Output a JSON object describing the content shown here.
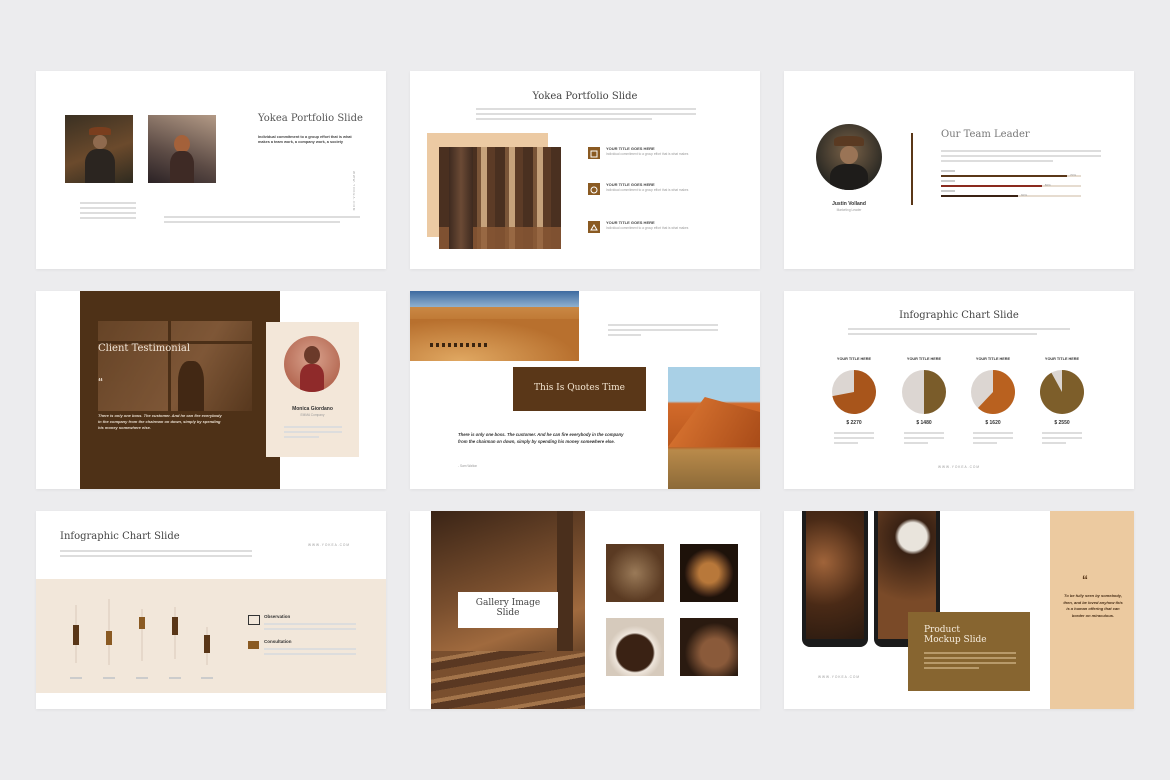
{
  "slide1": {
    "title": "Yokea Portfolio Slide",
    "lead": "Individual commitment to a group effort that is what makes a team work, a company work, a society",
    "vertical": "WWW.YOKEA.COM"
  },
  "slide2": {
    "title": "Yokea Portfolio Slide",
    "items": [
      {
        "title": "YOUR TITLE GOES HERE",
        "text": "Individual commitment to a group effort that is what makes"
      },
      {
        "title": "YOUR TITLE GOES HERE",
        "text": "Individual commitment to a group effort that is what makes"
      },
      {
        "title": "YOUR TITLE GOES HERE",
        "text": "Individual commitment to a group effort that is what makes"
      }
    ]
  },
  "slide3": {
    "title": "Our Team Leader",
    "name": "Justin Volland",
    "role": "Marketing Leader",
    "bars": [
      {
        "value": 0.9,
        "label": "70%"
      },
      {
        "value": 0.72,
        "label": "80%"
      },
      {
        "value": 0.55,
        "label": "60%"
      }
    ]
  },
  "slide4": {
    "title": "Client Testimonial",
    "quote": "There is only one boss. The customer. And he can fire everybody in the company from the chairman on down, simply by spending his money somewhere else.",
    "name": "Monica Giordano",
    "company": "EMMA Company"
  },
  "slide5": {
    "title": "This Is Quotes Time",
    "quote": "There is only one boss. The customer. And he can fire everybody in the company from the chairman on down, simply by spending his money somewhere else.",
    "author": "- Sam Walton"
  },
  "slide6": {
    "title": "Infographic Chart Slide",
    "items": [
      {
        "label": "YOUR TITLE HERE",
        "value": "$ 2270",
        "pct": 0.72,
        "color": "#a8551b"
      },
      {
        "label": "YOUR TITLE HERE",
        "value": "$ 1480",
        "pct": 0.5,
        "color": "#7a5c2a"
      },
      {
        "label": "YOUR TITLE HERE",
        "value": "$ 1620",
        "pct": 0.62,
        "color": "#b9611f"
      },
      {
        "label": "YOUR TITLE HERE",
        "value": "$ 2550",
        "pct": 0.92,
        "color": "#7d5e2a"
      }
    ],
    "footer": "WWW.YOKEA.COM"
  },
  "slide7": {
    "title": "Infographic Chart Slide",
    "url": "WWW.YOKEA.COM",
    "legend": [
      {
        "label": "Observation"
      },
      {
        "label": "Consultation"
      }
    ]
  },
  "slide8": {
    "title_line1": "Gallery Image",
    "title_line2": "Slide"
  },
  "slide9": {
    "title_line1": "Product",
    "title_line2": "Mockup Slide",
    "quote": "To be fully seen by somebody, then, and be loved anyhow this is a human offering that can border on miraculous.",
    "url": "WWW.YOKEA.COM"
  },
  "colors": {
    "brown": "#5a3718",
    "tan": "#ecc9a0",
    "gold": "#86642c",
    "cream": "#f2e7da"
  }
}
